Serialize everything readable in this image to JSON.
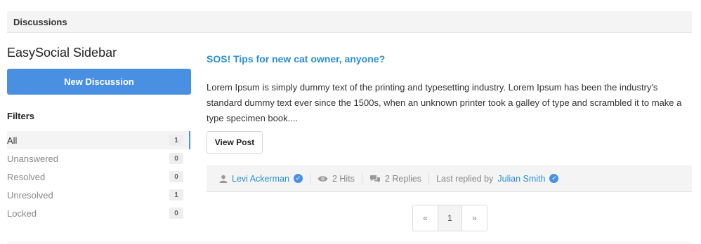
{
  "header": {
    "title": "Discussions"
  },
  "sidebar": {
    "title": "EasySocial Sidebar",
    "new_button": "New Discussion",
    "filters_title": "Filters",
    "filters": [
      {
        "label": "All",
        "count": "1",
        "active": true
      },
      {
        "label": "Unanswered",
        "count": "0"
      },
      {
        "label": "Resolved",
        "count": "0"
      },
      {
        "label": "Unresolved",
        "count": "1"
      },
      {
        "label": "Locked",
        "count": "0"
      }
    ]
  },
  "post": {
    "title": "SOS! Tips for new cat owner, anyone?",
    "body": "Lorem Ipsum is simply dummy text of the printing and typesetting industry. Lorem Ipsum has been the industry's standard dummy text ever since the 1500s, when an unknown printer took a galley of type and scrambled it to make a type specimen book....",
    "view_button": "View Post",
    "meta": {
      "author": "Levi Ackerman",
      "hits": "2 Hits",
      "replies": "2 Replies",
      "last_replied_label": "Last replied by",
      "last_replied_user": "Julian Smith"
    }
  },
  "pagination": {
    "prev": "«",
    "current": "1",
    "next": "»"
  },
  "colors": {
    "accent": "#4a90e2",
    "link": "#2a8fd6"
  },
  "icons": [
    "user-icon",
    "verified-badge-icon",
    "eye-icon",
    "comments-icon"
  ]
}
